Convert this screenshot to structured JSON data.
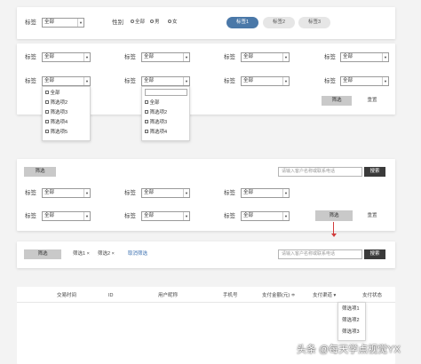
{
  "panel1": {
    "tag_label": "标签",
    "tag_select_value": "全部",
    "gender_label": "性别",
    "gender_options": [
      "全部",
      "男",
      "女"
    ],
    "tabs": [
      "标签1",
      "标签2",
      "标签3"
    ]
  },
  "panel2": {
    "rows": [
      [
        {
          "label": "标签",
          "value": "全部"
        },
        {
          "label": "标签",
          "value": "全部"
        },
        {
          "label": "标签",
          "value": "全部"
        },
        {
          "label": "标签",
          "value": "全部"
        }
      ],
      [
        {
          "label": "标签",
          "value": "全部"
        },
        {
          "label": "标签",
          "value": "全部"
        },
        {
          "label": "标签",
          "value": "全部"
        },
        {
          "label": "标签",
          "value": "全部"
        }
      ]
    ],
    "filter_label": "筛选",
    "reset_label": "重置",
    "dropdown1": [
      "全部",
      "筛选项2",
      "筛选项3",
      "筛选项4",
      "筛选项5"
    ],
    "dropdown2": [
      "全部",
      "筛选项2",
      "筛选项3",
      "筛选项4"
    ]
  },
  "panel3": {
    "filter_label": "筛选",
    "search_placeholder": "请输入客户名称或联系电话",
    "search_label": "搜索",
    "rows": [
      [
        {
          "label": "标签",
          "value": "全部"
        },
        {
          "label": "标签",
          "value": "全部"
        },
        {
          "label": "标签",
          "value": "全部"
        }
      ],
      [
        {
          "label": "标签",
          "value": "全部"
        },
        {
          "label": "标签",
          "value": "全部"
        },
        {
          "label": "标签",
          "value": "全部"
        }
      ]
    ],
    "filter_button": "筛选",
    "reset_label": "重置"
  },
  "panel4": {
    "filter_label": "筛选",
    "chips": [
      "筛选1 ×",
      "筛选2 ×"
    ],
    "clear_label": "取消筛选",
    "search_placeholder": "请输入客户名称或联系电话",
    "search_label": "搜索"
  },
  "table": {
    "headers": [
      "交易时间",
      "ID",
      "用户昵称",
      "手机号",
      "支付金额(元) ≑",
      "支付渠道 ▾",
      "支付状态"
    ],
    "channel_options": [
      "筛选项1",
      "筛选项2",
      "筛选项3"
    ]
  },
  "watermark": "头条 @每天学点视觉YX"
}
